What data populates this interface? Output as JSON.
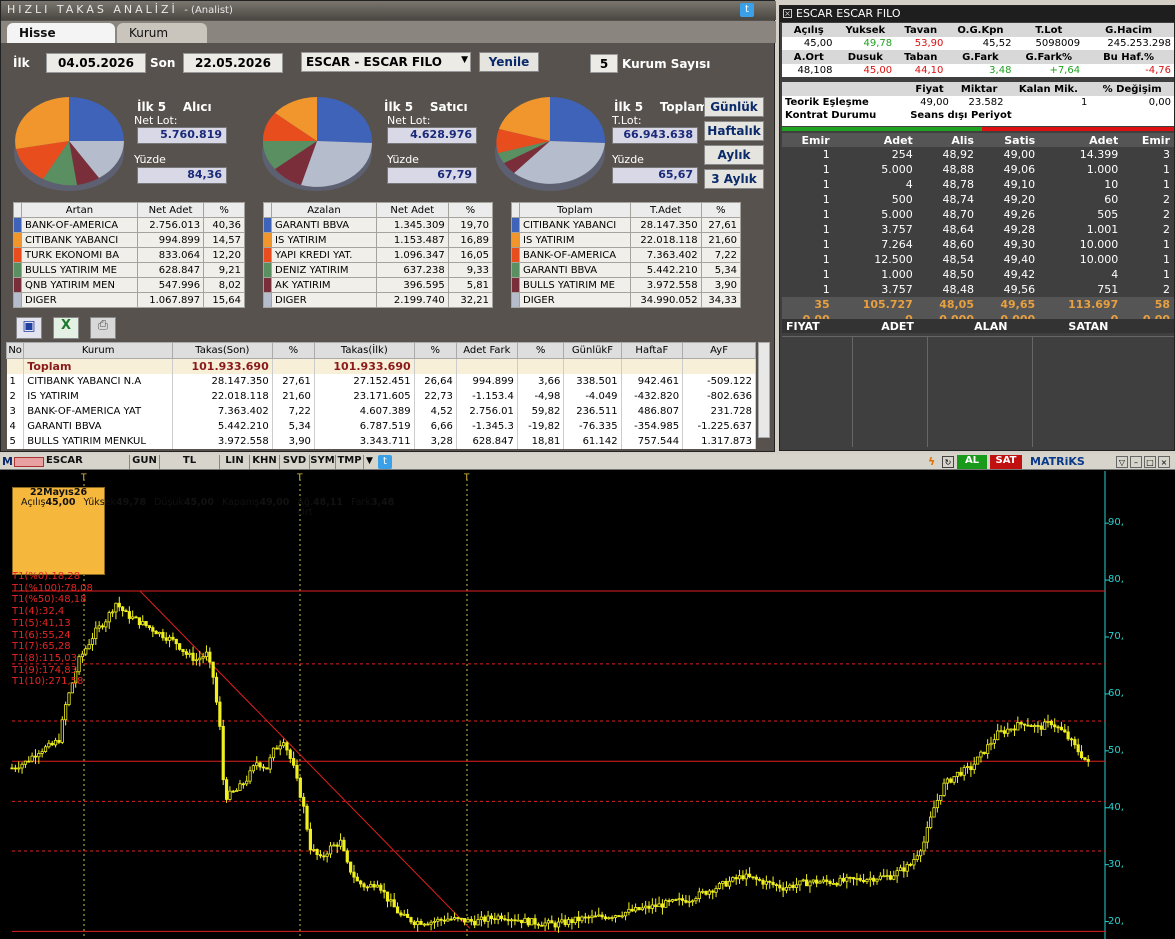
{
  "window": {
    "title": "HIZLI TAKAS ANALİZİ",
    "subtitle": "- (Analist)"
  },
  "tabs": [
    "Hisse",
    "Kurum"
  ],
  "filters": {
    "ilk_label": "İlk",
    "ilk_date": "04.05.2026",
    "son_label": "Son",
    "son_date": "22.05.2026",
    "symbol": "ESCAR - ESCAR FILO",
    "refresh": "Yenile",
    "kurum_count": "5",
    "kurum_label": "Kurum Sayısı"
  },
  "period_buttons": [
    "Günlük",
    "Haftalık",
    "Aylık",
    "3 Aylık"
  ],
  "pies": [
    {
      "title1": "İlk 5",
      "title2": "Alıcı",
      "lot_label": "Net Lot:",
      "lot": "5.760.819",
      "pct_label": "Yüzde",
      "pct": "84,36"
    },
    {
      "title1": "İlk 5",
      "title2": "Satıcı",
      "lot_label": "Net Lot:",
      "lot": "4.628.976",
      "pct_label": "Yüzde",
      "pct": "67,79"
    },
    {
      "title1": "İlk 5",
      "title2": "Toplam",
      "lot_label": "T.Lot:",
      "lot": "66.943.638",
      "pct_label": "Yüzde",
      "pct": "65,67"
    }
  ],
  "colors": {
    "c1": "#3f63b8",
    "c2": "#f0962c",
    "c3": "#e84d1e",
    "c4": "#5a8f62",
    "c5": "#7a2e3a",
    "c6": "#b5bccb"
  },
  "artan": {
    "headers": [
      "Artan",
      "Net Adet",
      "%"
    ],
    "rows": [
      [
        "BANK-OF-AMERICA",
        "2.756.013",
        "40,36"
      ],
      [
        "CITIBANK YABANCI",
        "994.899",
        "14,57"
      ],
      [
        "TURK EKONOMI BA",
        "833.064",
        "12,20"
      ],
      [
        "BULLS YATIRIM ME",
        "628.847",
        "9,21"
      ],
      [
        "QNB YATIRIM MEN",
        "547.996",
        "8,02"
      ],
      [
        "DIGER",
        "1.067.897",
        "15,64"
      ]
    ]
  },
  "azalan": {
    "headers": [
      "Azalan",
      "Net Adet",
      "%"
    ],
    "rows": [
      [
        "GARANTI BBVA",
        "1.345.309",
        "19,70"
      ],
      [
        "IS YATIRIM",
        "1.153.487",
        "16,89"
      ],
      [
        "YAPI KREDI YAT.",
        "1.096.347",
        "16,05"
      ],
      [
        "DENIZ YATIRIM",
        "637.238",
        "9,33"
      ],
      [
        "AK YATIRIM",
        "396.595",
        "5,81"
      ],
      [
        "DIGER",
        "2.199.740",
        "32,21"
      ]
    ]
  },
  "toplam": {
    "headers": [
      "Toplam",
      "T.Adet",
      "%"
    ],
    "rows": [
      [
        "CITIBANK YABANCI",
        "28.147.350",
        "27,61"
      ],
      [
        "IS YATIRIM",
        "22.018.118",
        "21,60"
      ],
      [
        "BANK-OF-AMERICA",
        "7.363.402",
        "7,22"
      ],
      [
        "GARANTI BBVA",
        "5.442.210",
        "5,34"
      ],
      [
        "BULLS YATIRIM ME",
        "3.972.558",
        "3,90"
      ],
      [
        "DIGER",
        "34.990.052",
        "34,33"
      ]
    ]
  },
  "main_table": {
    "headers": [
      "No",
      "Kurum",
      "Takas(Son)",
      "%",
      "Takas(İlk)",
      "%",
      "Adet Fark",
      "%",
      "GünlükF",
      "HaftaF",
      "AyF"
    ],
    "total": [
      "",
      "Toplam",
      "101.933.690",
      "",
      "101.933.690",
      "",
      "",
      "",
      "",
      "",
      ""
    ],
    "rows": [
      [
        "1",
        "CITIBANK YABANCI N.A",
        "28.147.350",
        "27,61",
        "27.152.451",
        "26,64",
        "994.899",
        "3,66",
        "338.501",
        "942.461",
        "-509.122"
      ],
      [
        "2",
        "IS YATIRIM",
        "22.018.118",
        "21,60",
        "23.171.605",
        "22,73",
        "-1.153.4",
        "-4,98",
        "-4.049",
        "-432.820",
        "-802.636"
      ],
      [
        "3",
        "BANK-OF-AMERICA YAT",
        "7.363.402",
        "7,22",
        "4.607.389",
        "4,52",
        "2.756.01",
        "59,82",
        "236.511",
        "486.807",
        "231.728"
      ],
      [
        "4",
        "GARANTI BBVA",
        "5.442.210",
        "5,34",
        "6.787.519",
        "6,66",
        "-1.345.3",
        "-19,82",
        "-76.335",
        "-354.985",
        "-1.225.637"
      ],
      [
        "5",
        "BULLS YATIRIM MENKUL",
        "3.972.558",
        "3,90",
        "3.343.711",
        "3,28",
        "628.847",
        "18,81",
        "61.142",
        "757.544",
        "1.317.873"
      ]
    ]
  },
  "quote": {
    "title": "ESCAR    ESCAR FILO",
    "h1": [
      "Açılış",
      "Yuksek",
      "Tavan",
      "O.G.Kpn",
      "T.Lot",
      "G.Hacim"
    ],
    "v1": [
      "45,00",
      "49,78",
      "53,90",
      "45,52",
      "5098009",
      "245.253.298"
    ],
    "h2": [
      "A.Ort",
      "Dusuk",
      "Taban",
      "G.Fark",
      "G.Fark%",
      "Bu Haf.%"
    ],
    "v2": [
      "48,108",
      "45,00",
      "44,10",
      "3,48",
      "+7,64",
      "-4,76"
    ],
    "h3": [
      "",
      "Fiyat",
      "Miktar",
      "Kalan Mik.",
      "% Değişim"
    ],
    "teorik": [
      "Teorik Eşleşme",
      "49,00",
      "23.582",
      "1",
      "0,00"
    ],
    "kontrat": [
      "Kontrat Durumu",
      "Seans dışı Periyot"
    ]
  },
  "book": {
    "headers": [
      "Emir",
      "Adet",
      "Alis",
      "Satis",
      "Adet",
      "Emir"
    ],
    "rows": [
      [
        "1",
        "254",
        "48,92",
        "49,00",
        "14.399",
        "3"
      ],
      [
        "1",
        "5.000",
        "48,88",
        "49,06",
        "1.000",
        "1"
      ],
      [
        "1",
        "4",
        "48,78",
        "49,10",
        "10",
        "1"
      ],
      [
        "1",
        "500",
        "48,74",
        "49,20",
        "60",
        "2"
      ],
      [
        "1",
        "5.000",
        "48,70",
        "49,26",
        "505",
        "2"
      ],
      [
        "1",
        "3.757",
        "48,64",
        "49,28",
        "1.001",
        "2"
      ],
      [
        "1",
        "7.264",
        "48,60",
        "49,30",
        "10.000",
        "1"
      ],
      [
        "1",
        "12.500",
        "48,54",
        "49,40",
        "10.000",
        "1"
      ],
      [
        "1",
        "1.000",
        "48,50",
        "49,42",
        "4",
        "1"
      ],
      [
        "1",
        "3.757",
        "48,48",
        "49,56",
        "751",
        "2"
      ]
    ],
    "sum": [
      "35",
      "105.727",
      "48,05",
      "49,65",
      "113.697",
      "58"
    ],
    "zero": [
      "0,00",
      "0",
      "0,000",
      "0,000",
      "0",
      "0,00"
    ]
  },
  "trades_headers": [
    "FIYAT",
    "ADET",
    "ALAN",
    "SATAN"
  ],
  "chart_bar": {
    "symbol": "ESCAR",
    "buttons": [
      "GUN",
      "TL",
      "LIN",
      "KHN",
      "SVD",
      "SYM",
      "TMP"
    ],
    "al": "AL",
    "sat": "SAT",
    "brand": "MATRiKS"
  },
  "infobox": {
    "date": "22Mayıs26",
    "rows": [
      [
        "Açılış",
        "45,00"
      ],
      [
        "Yüksek",
        "49,78"
      ],
      [
        "Düşük",
        "45,00"
      ],
      [
        "Kapanış",
        "49,00"
      ],
      [
        "Ağ. Ort",
        "48,11"
      ],
      [
        "Fark",
        "3,48"
      ]
    ]
  },
  "fib_labels": [
    "T1(%0):18,28",
    "T1(%100):78,08",
    "T1(%50):48,18",
    "T1(4):32,4",
    "T1(5):41,13",
    "T1(6):55,24",
    "T1(7):65,28",
    "T1(8):115,03",
    "T1(9):174,83",
    "T1(10):271,58"
  ],
  "chart_data": {
    "type": "candlestick",
    "y_ticks": [
      "90,",
      "80,",
      "70,",
      "60,",
      "50,",
      "40,",
      "30,",
      "20,"
    ],
    "ylim": [
      18,
      96
    ],
    "t_markers": [
      "T",
      "T",
      "T"
    ],
    "price_path": [
      [
        0,
        47
      ],
      [
        4,
        48
      ],
      [
        8,
        50
      ],
      [
        12,
        51
      ],
      [
        14,
        52
      ],
      [
        16,
        58
      ],
      [
        18,
        62
      ],
      [
        20,
        66
      ],
      [
        22,
        68
      ],
      [
        25,
        71
      ],
      [
        28,
        73
      ],
      [
        31,
        76
      ],
      [
        34,
        74
      ],
      [
        37,
        73
      ],
      [
        40,
        72
      ],
      [
        43,
        71
      ],
      [
        46,
        70
      ],
      [
        49,
        69
      ],
      [
        52,
        67
      ],
      [
        55,
        66
      ],
      [
        58,
        67
      ],
      [
        60,
        63
      ],
      [
        62,
        54
      ],
      [
        63,
        45
      ],
      [
        64,
        42
      ],
      [
        67,
        43
      ],
      [
        70,
        45
      ],
      [
        73,
        48
      ],
      [
        76,
        47
      ],
      [
        78,
        50
      ],
      [
        81,
        52
      ],
      [
        84,
        47
      ],
      [
        87,
        40
      ],
      [
        89,
        33
      ],
      [
        92,
        31
      ],
      [
        95,
        33
      ],
      [
        98,
        34
      ],
      [
        100,
        30
      ],
      [
        103,
        27
      ],
      [
        106,
        26
      ],
      [
        109,
        27
      ],
      [
        112,
        24
      ],
      [
        116,
        21
      ],
      [
        120,
        20
      ],
      [
        125,
        20
      ],
      [
        130,
        20.5
      ],
      [
        138,
        20
      ],
      [
        146,
        21
      ],
      [
        154,
        20
      ],
      [
        162,
        19.5
      ],
      [
        170,
        20.5
      ],
      [
        178,
        21
      ],
      [
        186,
        22
      ],
      [
        194,
        23
      ],
      [
        202,
        24
      ],
      [
        210,
        26
      ],
      [
        218,
        28
      ],
      [
        224,
        27
      ],
      [
        230,
        26
      ],
      [
        238,
        27
      ],
      [
        246,
        27
      ],
      [
        254,
        27.5
      ],
      [
        262,
        28
      ],
      [
        268,
        30
      ],
      [
        272,
        34
      ],
      [
        275,
        40
      ],
      [
        278,
        44
      ],
      [
        282,
        46
      ],
      [
        286,
        47
      ],
      [
        290,
        50
      ],
      [
        294,
        53
      ],
      [
        298,
        54
      ],
      [
        302,
        55
      ],
      [
        306,
        54
      ],
      [
        310,
        55
      ],
      [
        314,
        53
      ],
      [
        318,
        50
      ],
      [
        322,
        47
      ]
    ]
  }
}
